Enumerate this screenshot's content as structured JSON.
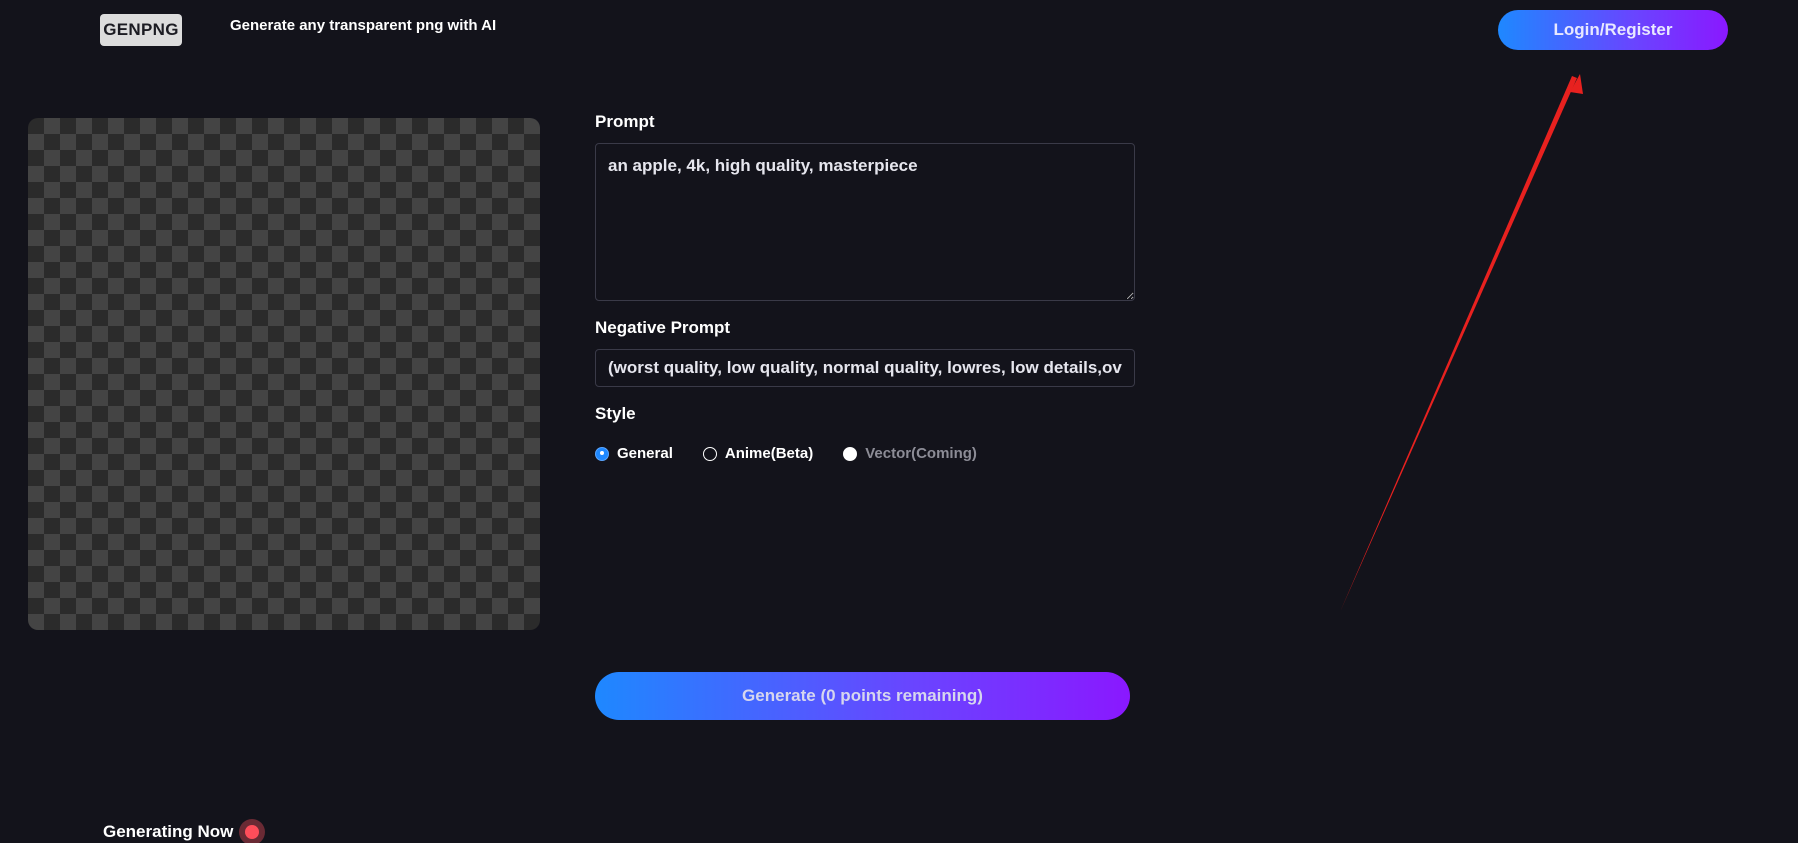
{
  "header": {
    "logo": "GENPNG",
    "tagline": "Generate any transparent png with AI",
    "login_label": "Login/Register"
  },
  "form": {
    "prompt_label": "Prompt",
    "prompt_value": "an apple, 4k, high quality, masterpiece",
    "negative_label": "Negative Prompt",
    "negative_value": "(worst quality, low quality, normal quality, lowres, low details,ov",
    "style_label": "Style",
    "style_options": [
      {
        "label": "General",
        "selected": true
      },
      {
        "label": "Anime(Beta)",
        "selected": false
      },
      {
        "label": "Vector(Coming)",
        "selected": false,
        "disabled": true
      }
    ],
    "generate_label": "Generate (0 points remaining)"
  },
  "status": {
    "generating_now": "Generating Now"
  },
  "colors": {
    "background": "#13131b",
    "accent_gradient_start": "#1e88ff",
    "accent_gradient_end": "#8a18ff",
    "annotation_arrow": "#e8211f",
    "live_dot": "#ff4d5a"
  }
}
